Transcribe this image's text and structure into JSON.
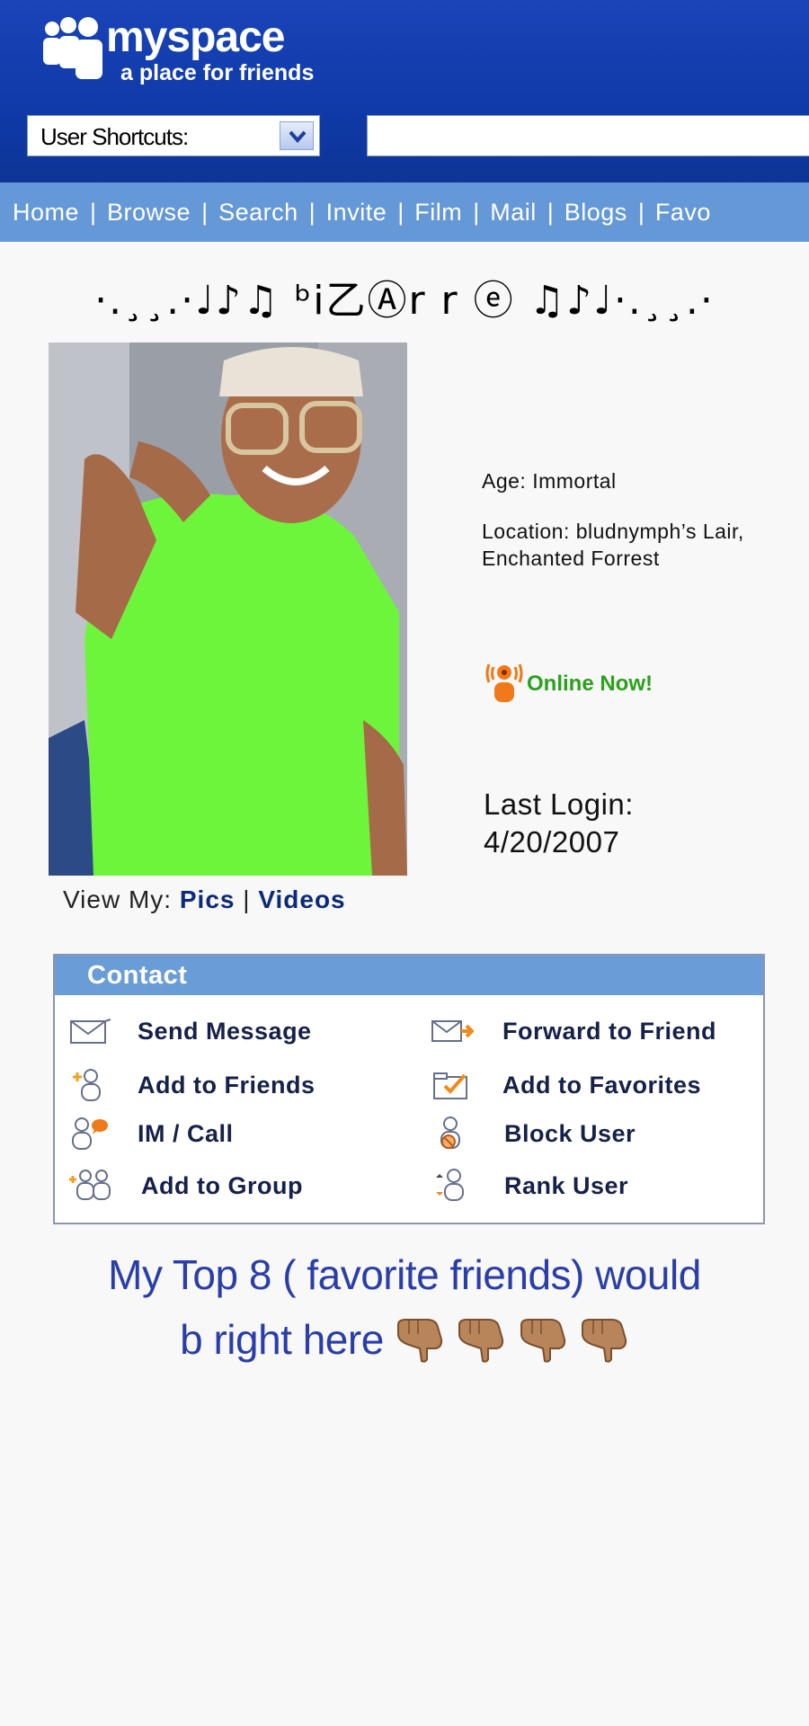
{
  "header": {
    "logo_word": "myspace",
    "logo_tagline": "a place for friends",
    "shortcuts_label": "User Shortcuts:",
    "search_value": ""
  },
  "nav": {
    "items": [
      "Home",
      "Browse",
      "Search",
      "Invite",
      "Film",
      "Mail",
      "Blogs",
      "Favo"
    ]
  },
  "profile": {
    "name": "·.¸¸.·♩♪♫ ᵇi乙Ⓐr r ⓔ ♫♪♩·.¸¸.·",
    "view_my_label": "View My:",
    "pics_link": "Pics",
    "divider": "|",
    "videos_link": "Videos",
    "age": "Age: Immortal",
    "location": "Location: bludnymph’s Lair, Enchanted Forrest",
    "online_status": "Online Now!",
    "last_login_label": "Last Login:",
    "last_login_date": "4/20/2007"
  },
  "contact": {
    "title": "Contact",
    "send_message": "Send Message",
    "forward_to_friend": "Forward to Friend",
    "add_to_friends": "Add to Friends",
    "add_to_favorites": "Add to Favorites",
    "im_call": "IM / Call",
    "block_user": "Block User",
    "add_to_group": "Add to Group",
    "rank_user": "Rank User"
  },
  "caption": {
    "line1": "My Top 8 ( favorite friends) would",
    "line2": "b right here"
  },
  "colors": {
    "header_blue": "#1a44b8",
    "nav_blue": "#6598d6",
    "online_green": "#2aa11b",
    "caption_blue": "#2a3ea8"
  }
}
